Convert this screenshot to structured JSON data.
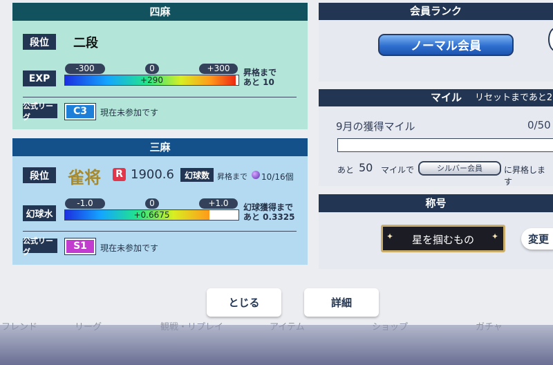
{
  "yonma": {
    "title": "四麻",
    "rank_label": "段位",
    "rank_value": "二段",
    "exp_label": "EXP",
    "exp_min": "-300",
    "exp_mid": "0",
    "exp_max": "+300",
    "exp_value": "+290",
    "exp_fill_fraction": 0.983,
    "promote_line1": "昇格まで",
    "promote_line2": "あと 10",
    "league_label": "公式リーグ",
    "league_badge": "C3",
    "league_status": "現在未参加です"
  },
  "sanma": {
    "title": "三麻",
    "rank_label": "段位",
    "rank_value": "雀将",
    "rating_badge": "R",
    "rating_value": "1900.6",
    "orb_label": "幻球数",
    "orb_prefix": "昇格まで",
    "orb_count": "10/16個",
    "level_label": "幻球水",
    "level_min": "-1.0",
    "level_mid": "0",
    "level_max": "+1.0",
    "level_value": "+0.6675",
    "level_fill_fraction": 0.834,
    "gain_line1": "幻球獲得まで",
    "gain_line2": "あと 0.3325",
    "league_label": "公式リーグ",
    "league_badge": "S1",
    "league_status": "現在未参加です"
  },
  "membership": {
    "title": "会員ランク",
    "rank_button": "ノーマル会員"
  },
  "mile": {
    "title": "マイル",
    "reset_text": "リセットまであと2",
    "month_label": "9月の獲得マイル",
    "progress": "0/50",
    "progress_fraction": 0.0,
    "remain_prefix": "あと",
    "remain_value": "50",
    "remain_unit": "マイルで",
    "next_rank": "シルバー会員",
    "remain_suffix": "に昇格します"
  },
  "title_section": {
    "title": "称号",
    "badge_text": "星を掴むもの",
    "change_button": "変更"
  },
  "actions": {
    "close": "とじる",
    "details": "詳細"
  },
  "bottom_nav": [
    "フレンド",
    "リーグ",
    "観戦・リプレイ",
    "アイテム",
    "ショップ",
    "ガチャ"
  ],
  "colors": {
    "yonma_header": "#12525f",
    "yonma_body": "#b3e6d8",
    "sanma_header": "#14508a",
    "sanma_body": "#b3daf0",
    "dark_label": "#223552",
    "league_c3": "#1d7fd8",
    "league_s1": "#c33cd0",
    "rating_red": "#e2374a",
    "member_blue": "#2f6fcf"
  }
}
